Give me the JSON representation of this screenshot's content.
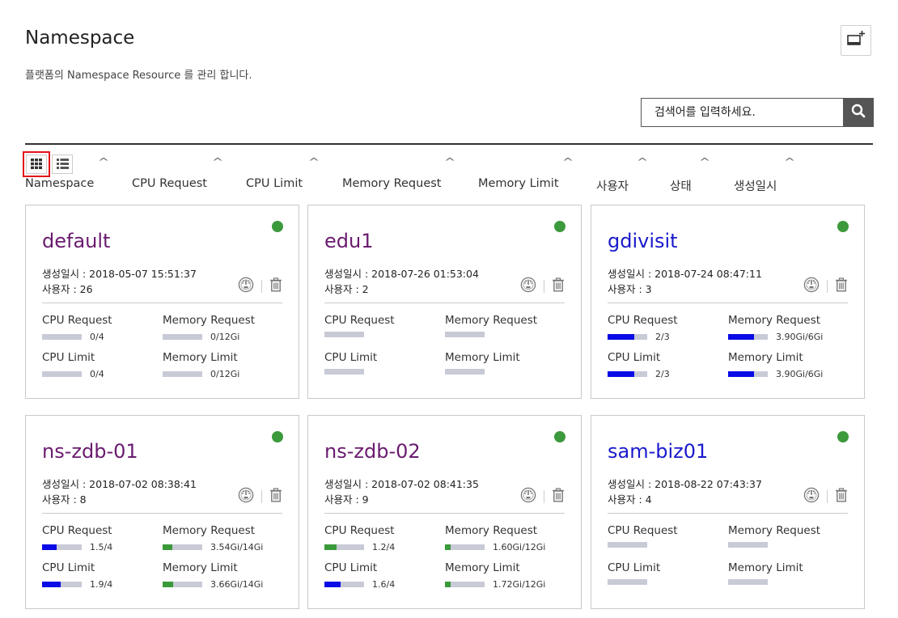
{
  "page": {
    "title": "Namespace",
    "subtitle": "플랫폼의 Namespace Resource 를 관리 합니다."
  },
  "search": {
    "placeholder": "검색어를 입력하세요."
  },
  "sort_columns": [
    "Namespace",
    "CPU Request",
    "CPU Limit",
    "Memory Request",
    "Memory Limit",
    "사용자",
    "상태",
    "생성일시"
  ],
  "labels": {
    "created": "생성일시 : ",
    "users": "사용자 : ",
    "cpu_request": "CPU Request",
    "memory_request": "Memory Request",
    "cpu_limit": "CPU Limit",
    "memory_limit": "Memory Limit"
  },
  "colors": {
    "status_ok": "#3c9a3c",
    "cpu_fill": "#0a0ae6",
    "mem_fill": "#3a9a3a",
    "name_purple": "#6a1b6f",
    "name_blue": "#1a1acc"
  },
  "namespaces": [
    {
      "name": "default",
      "name_color": "purple",
      "created": "2018-05-07 15:51:37",
      "users": "26",
      "cpu_request": {
        "text": "0/4",
        "pct": 0,
        "color": "cpu"
      },
      "memory_request": {
        "text": "0/12Gi",
        "pct": 0,
        "color": "mem"
      },
      "cpu_limit": {
        "text": "0/4",
        "pct": 0,
        "color": "cpu"
      },
      "memory_limit": {
        "text": "0/12Gi",
        "pct": 0,
        "color": "mem"
      }
    },
    {
      "name": "edu1",
      "name_color": "purple",
      "created": "2018-07-26 01:53:04",
      "users": "2",
      "cpu_request": {
        "text": "",
        "pct": 0,
        "color": "cpu"
      },
      "memory_request": {
        "text": "",
        "pct": 0,
        "color": "mem"
      },
      "cpu_limit": {
        "text": "",
        "pct": 0,
        "color": "cpu"
      },
      "memory_limit": {
        "text": "",
        "pct": 0,
        "color": "mem"
      }
    },
    {
      "name": "gdivisit",
      "name_color": "blue",
      "created": "2018-07-24 08:47:11",
      "users": "3",
      "cpu_request": {
        "text": "2/3",
        "pct": 66.7,
        "color": "cpu"
      },
      "memory_request": {
        "text": "3.90Gi/6Gi",
        "pct": 65,
        "color": "cpu"
      },
      "cpu_limit": {
        "text": "2/3",
        "pct": 66.7,
        "color": "cpu"
      },
      "memory_limit": {
        "text": "3.90Gi/6Gi",
        "pct": 65,
        "color": "cpu"
      }
    },
    {
      "name": "ns-zdb-01",
      "name_color": "purple",
      "created": "2018-07-02 08:38:41",
      "users": "8",
      "cpu_request": {
        "text": "1.5/4",
        "pct": 37.5,
        "color": "cpu"
      },
      "memory_request": {
        "text": "3.54Gi/14Gi",
        "pct": 25.3,
        "color": "mem"
      },
      "cpu_limit": {
        "text": "1.9/4",
        "pct": 47.5,
        "color": "cpu"
      },
      "memory_limit": {
        "text": "3.66Gi/14Gi",
        "pct": 26.1,
        "color": "mem"
      }
    },
    {
      "name": "ns-zdb-02",
      "name_color": "purple",
      "created": "2018-07-02 08:41:35",
      "users": "9",
      "cpu_request": {
        "text": "1.2/4",
        "pct": 30,
        "color": "mem"
      },
      "memory_request": {
        "text": "1.60Gi/12Gi",
        "pct": 13.3,
        "color": "mem"
      },
      "cpu_limit": {
        "text": "1.6/4",
        "pct": 40,
        "color": "cpu"
      },
      "memory_limit": {
        "text": "1.72Gi/12Gi",
        "pct": 14.3,
        "color": "mem"
      }
    },
    {
      "name": "sam-biz01",
      "name_color": "blue",
      "created": "2018-08-22 07:43:37",
      "users": "4",
      "cpu_request": {
        "text": "",
        "pct": 0,
        "color": "cpu"
      },
      "memory_request": {
        "text": "",
        "pct": 0,
        "color": "mem"
      },
      "cpu_limit": {
        "text": "",
        "pct": 0,
        "color": "cpu"
      },
      "memory_limit": {
        "text": "",
        "pct": 0,
        "color": "mem"
      }
    }
  ]
}
